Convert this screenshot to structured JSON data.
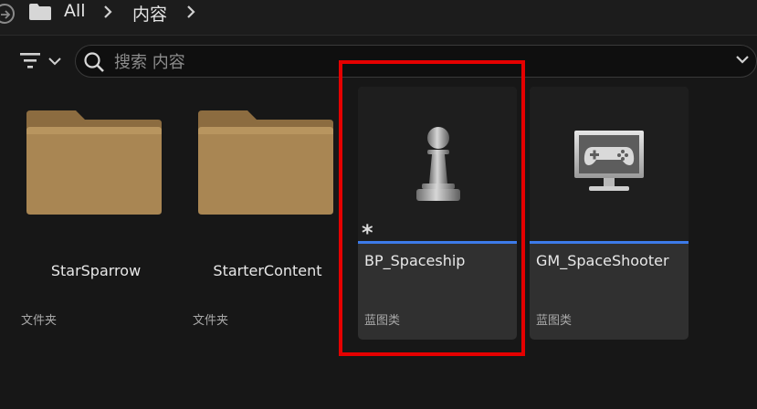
{
  "breadcrumb": {
    "root": "All",
    "current": "内容"
  },
  "search": {
    "placeholder": "搜索 内容",
    "value": ""
  },
  "items": [
    {
      "name": "StarSparrow",
      "type": "文件夹",
      "icon": "folder-icon"
    },
    {
      "name": "StarterContent",
      "type": "文件夹",
      "icon": "folder-icon"
    },
    {
      "name": "BP_Spaceship",
      "type": "蓝图类",
      "icon": "pawn-icon",
      "marker": "*"
    },
    {
      "name": "GM_SpaceShooter",
      "type": "蓝图类",
      "icon": "game-mode-icon"
    }
  ],
  "colors": {
    "background": "#171717",
    "card": "#303030",
    "accent_bar": "#3d7bea",
    "highlight": "#e50000",
    "folder": "#a98653"
  }
}
